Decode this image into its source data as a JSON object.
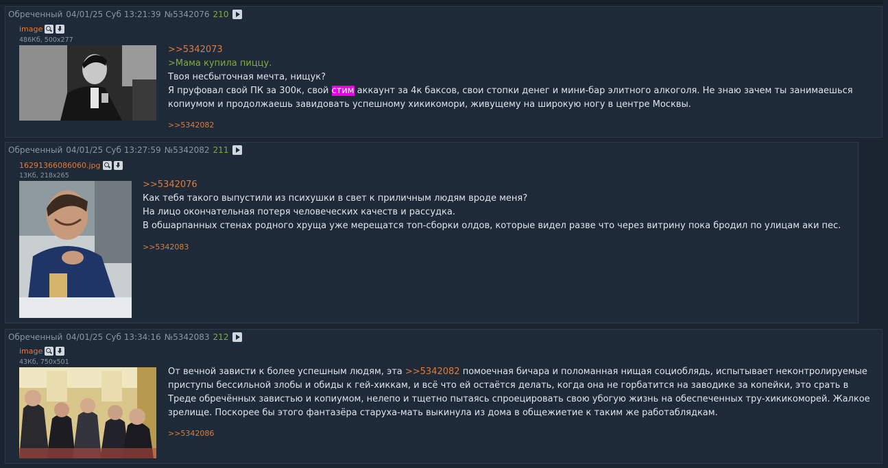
{
  "posts": [
    {
      "name": "Обреченный",
      "date": "04/01/25 Суб 13:21:39",
      "num": "№5342076",
      "count": "210",
      "file_name": "image",
      "file_meta": "486Кб, 500x277",
      "reflink": ">>5342073",
      "quote": ">Мама купила пиццу.",
      "line1": "Твоя несбыточная мечта, нищук?",
      "line2_a": "Я пруфовал свой ПК за 300к, свой ",
      "line2_hl": "стим",
      "line2_b": " аккаунт за 4к баксов, свои стопки денег и мини-бар элитного алкоголя. Не знаю зачем ты занимаешься копиумом и продолжаешь завидовать успешному хикикомори, живущему на широкую ногу в центре Москвы.",
      "reply": ">>5342082"
    },
    {
      "name": "Обреченный",
      "date": "04/01/25 Суб 13:27:59",
      "num": "№5342082",
      "count": "211",
      "file_name": "16291366086060.jpg",
      "file_meta": "13Кб, 218x265",
      "reflink": ">>5342076",
      "line1": "Как тебя такого выпустили из психушки в свет к приличным людям вроде меня?",
      "line2": "На лицо окончательная потеря человеческих качеств и рассудка.",
      "line3": "В обшарпанных стенах родного хруща уже мерещатся топ-сборки олдов, которые видел разве что через витрину пока бродил по улицам аки пес.",
      "reply": ">>5342083"
    },
    {
      "name": "Обреченный",
      "date": "04/01/25 Суб 13:34:16",
      "num": "№5342083",
      "count": "212",
      "file_name": "image",
      "file_meta": "43Кб, 750x501",
      "text_a": "От вечной зависти к более успешным людям, эта ",
      "reflink": ">>5342082",
      "text_b": " помоечная бичара и поломанная нищая социоблядь, испытывает неконтролируемые приступы бессильной злобы и обиды к гей-хиккам, и всё что ей остаётся делать, когда она не горбатится на заводике за копейки, это срать в Треде обречённых завистью и копиумом, нелепо и тщетно пытаясь спроецировать свою убогую жизнь на обеспеченных тру-хикикоморей. Жалкое зрелище. Поскорее бы этого фантазёра старуха-мать выкинула из дома в общежиетие к таким же работаблядкам.",
      "reply": ">>5342086"
    }
  ],
  "colors": {
    "background": "#1a2531",
    "post_bg": "#1e2a38",
    "reflink": "#e07b39",
    "greentext": "#7fae3c",
    "highlight": "#e800e8"
  },
  "icons": [
    "play-icon",
    "search-icon",
    "download-icon"
  ]
}
